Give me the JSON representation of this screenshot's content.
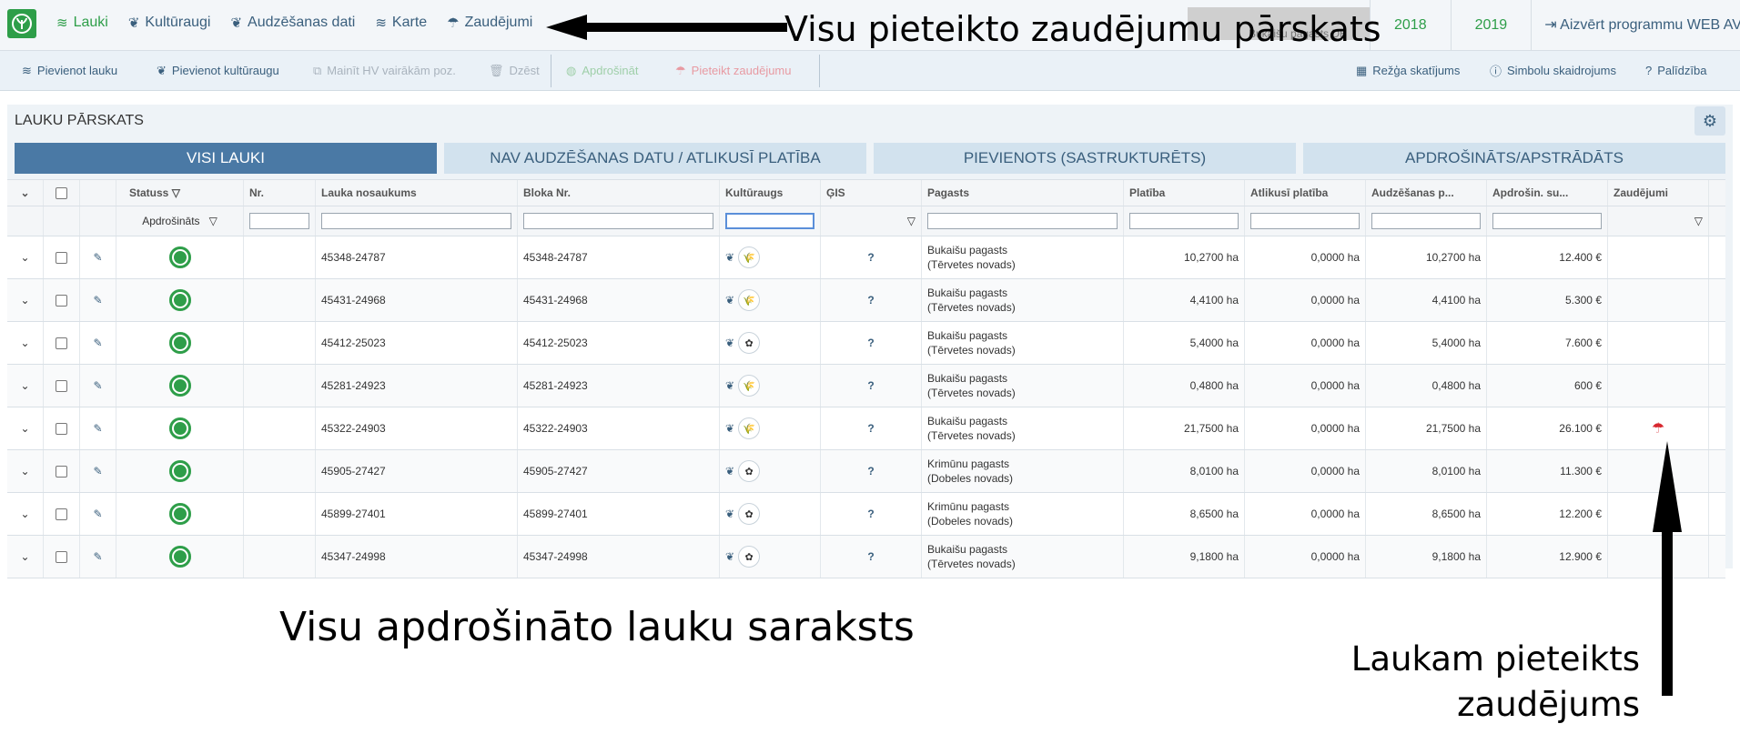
{
  "nav": {
    "items": [
      {
        "label": "Lauki",
        "icon": "layers-icon",
        "active": true
      },
      {
        "label": "Kultūraugi",
        "icon": "plant-icon"
      },
      {
        "label": "Audzēšanas dati",
        "icon": "plant-icon"
      },
      {
        "label": "Karte",
        "icon": "map-icon"
      },
      {
        "label": "Zaudējumi",
        "icon": "umbrella-icon"
      }
    ],
    "hidden_text": "Bukaišu pagasts DB",
    "years": [
      "2018",
      "2019"
    ],
    "close_label": "Aizvērt programmu WEB AV®"
  },
  "toolbar": {
    "add_field": "Pievienot lauku",
    "add_crop": "Pievienot kultūraugu",
    "change_hv": "Mainīt HV vairākām poz.",
    "delete": "Dzēst",
    "insure": "Apdrošināt",
    "report_loss": "Pieteikt zaudējumu",
    "grid_view": "Režģa skatījums",
    "legend": "Simbolu skaidrojums",
    "help": "Palīdzība"
  },
  "panel": {
    "title": "LAUKU PĀRSKATS",
    "tabs": [
      "VISI LAUKI",
      "NAV AUDZĒŠANAS DATU / ATLIKUSĪ PLATĪBA",
      "PIEVIENOTS (SASTRUKTURĒTS)",
      "APDROŠINĀTS/APSTRĀDĀTS"
    ]
  },
  "table": {
    "headers": [
      "Statuss",
      "Nr.",
      "Lauka nosaukums",
      "Bloka Nr.",
      "Kultūraugs",
      "ĢIS",
      "Pagasts",
      "Platība",
      "Atlikusī platība",
      "Audzēšanas p...",
      "Apdrošin. su...",
      "Zaudējumi"
    ],
    "status_filter": "Apdrošināts",
    "rows": [
      {
        "name": "45348-24787",
        "block": "45348-24787",
        "crop": "grain",
        "gis": "?",
        "parish1": "Bukaišu pagasts",
        "parish2": "(Tērvetes novads)",
        "area": "10,2700 ha",
        "remaining": "0,0000 ha",
        "grow": "10,2700 ha",
        "insured": "12.400 €",
        "loss": false
      },
      {
        "name": "45431-24968",
        "block": "45431-24968",
        "crop": "grain",
        "gis": "?",
        "parish1": "Bukaišu pagasts",
        "parish2": "(Tērvetes novads)",
        "area": "4,4100 ha",
        "remaining": "0,0000 ha",
        "grow": "4,4100 ha",
        "insured": "5.300 €",
        "loss": false
      },
      {
        "name": "45412-25023",
        "block": "45412-25023",
        "crop": "rape",
        "gis": "?",
        "parish1": "Bukaišu pagasts",
        "parish2": "(Tērvetes novads)",
        "area": "5,4000 ha",
        "remaining": "0,0000 ha",
        "grow": "5,4000 ha",
        "insured": "7.600 €",
        "loss": false
      },
      {
        "name": "45281-24923",
        "block": "45281-24923",
        "crop": "grain",
        "gis": "?",
        "parish1": "Bukaišu pagasts",
        "parish2": "(Tērvetes novads)",
        "area": "0,4800 ha",
        "remaining": "0,0000 ha",
        "grow": "0,4800 ha",
        "insured": "600 €",
        "loss": false
      },
      {
        "name": "45322-24903",
        "block": "45322-24903",
        "crop": "grain",
        "gis": "?",
        "parish1": "Bukaišu pagasts",
        "parish2": "(Tērvetes novads)",
        "area": "21,7500 ha",
        "remaining": "0,0000 ha",
        "grow": "21,7500 ha",
        "insured": "26.100 €",
        "loss": true
      },
      {
        "name": "45905-27427",
        "block": "45905-27427",
        "crop": "rape",
        "gis": "?",
        "parish1": "Krimūnu pagasts",
        "parish2": "(Dobeles novads)",
        "area": "8,0100 ha",
        "remaining": "0,0000 ha",
        "grow": "8,0100 ha",
        "insured": "11.300 €",
        "loss": false
      },
      {
        "name": "45899-27401",
        "block": "45899-27401",
        "crop": "rape",
        "gis": "?",
        "parish1": "Krimūnu pagasts",
        "parish2": "(Dobeles novads)",
        "area": "8,6500 ha",
        "remaining": "0,0000 ha",
        "grow": "8,6500 ha",
        "insured": "12.200 €",
        "loss": false
      },
      {
        "name": "45347-24998",
        "block": "45347-24998",
        "crop": "rape",
        "gis": "?",
        "parish1": "Bukaišu pagasts",
        "parish2": "(Tērvetes novads)",
        "area": "9,1800 ha",
        "remaining": "0,0000 ha",
        "grow": "9,1800 ha",
        "insured": "12.900 €",
        "loss": false
      }
    ]
  },
  "annotations": {
    "top": "Visu pieteikto zaudējumu pārskats",
    "middle": "Visu apdrošināto lauku saraksts",
    "right_line1": "Laukam pieteikts",
    "right_line2": "zaudējums"
  },
  "colors": {
    "brand_green": "#2e9e49",
    "nav_blue": "#3a5f7d",
    "tab_active": "#4a79a5",
    "loss_red": "#d8282f"
  }
}
